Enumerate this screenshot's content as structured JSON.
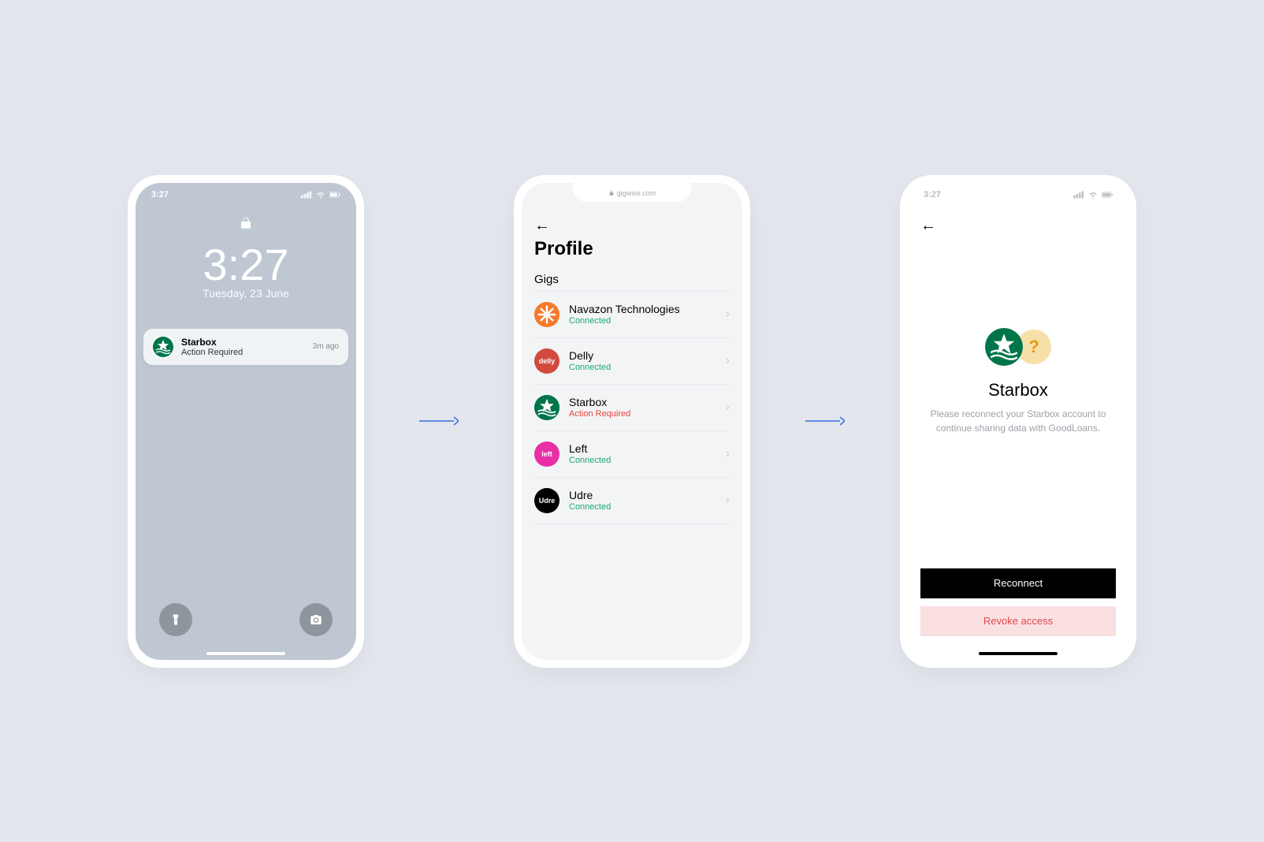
{
  "lockScreen": {
    "statusTime": "3:27",
    "bigTime": "3:27",
    "date": "Tuesday,  23 June",
    "notification": {
      "app": "Starbox",
      "body": "Action Required",
      "timeAgo": "3m ago"
    }
  },
  "profileScreen": {
    "url": "gigwise.com",
    "title": "Profile",
    "section": "Gigs",
    "gigs": [
      {
        "name": "Navazon Technologies",
        "status": "Connected",
        "statusClass": "status-connected",
        "logoBg": "#f47a2b",
        "logoLabel": ""
      },
      {
        "name": "Delly",
        "status": "Connected",
        "statusClass": "status-connected",
        "logoBg": "#d14a3d",
        "logoLabel": "delly"
      },
      {
        "name": "Starbox",
        "status": "Action Required",
        "statusClass": "status-action",
        "logoBg": "#00754a",
        "logoLabel": ""
      },
      {
        "name": "Left",
        "status": "Connected",
        "statusClass": "status-connected",
        "logoBg": "#e92fa5",
        "logoLabel": "left"
      },
      {
        "name": "Udre",
        "status": "Connected",
        "statusClass": "status-connected",
        "logoBg": "#000000",
        "logoLabel": "Udre"
      }
    ]
  },
  "reconnectScreen": {
    "statusTime": "3:27",
    "title": "Starbox",
    "description": "Please reconnect your Starbox account to continue sharing data with GoodLoans.",
    "primaryButton": "Reconnect",
    "secondaryButton": "Revoke access",
    "questionMark": "?"
  }
}
